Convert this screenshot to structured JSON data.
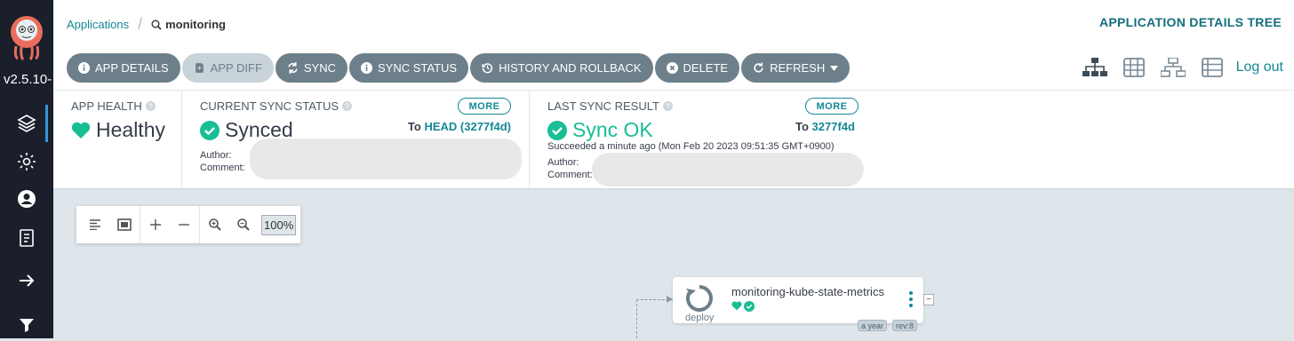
{
  "sidebar": {
    "version": "v2.5.10-",
    "nav": [
      "applications-icon",
      "settings-icon",
      "user-icon",
      "docs-icon",
      "expand-arrow-icon",
      "filter-icon"
    ]
  },
  "breadcrumb": {
    "root": "Applications",
    "current": "monitoring"
  },
  "page_title": "APPLICATION DETAILS TREE",
  "toolbar": {
    "app_details": "APP DETAILS",
    "app_diff": "APP DIFF",
    "sync": "SYNC",
    "sync_status": "SYNC STATUS",
    "history": "HISTORY AND ROLLBACK",
    "delete": "DELETE",
    "refresh": "REFRESH",
    "logout": "Log out"
  },
  "app_health": {
    "title": "APP HEALTH",
    "status": "Healthy",
    "color": "#18be94"
  },
  "sync_status": {
    "title": "CURRENT SYNC STATUS",
    "status": "Synced",
    "more": "MORE",
    "to_label": "To",
    "revision": "HEAD (3277f4d)",
    "author_label": "Author:",
    "comment_label": "Comment:"
  },
  "last_sync": {
    "title": "LAST SYNC RESULT",
    "status": "Sync OK",
    "more": "MORE",
    "to_label": "To",
    "revision": "3277f4d",
    "succeeded": "Succeeded a minute ago (Mon Feb 20 2023 09:51:35 GMT+0900)",
    "author_label": "Author:",
    "comment_label": "Comment:",
    "color": "#18be94"
  },
  "zoom": {
    "level": "100%"
  },
  "node": {
    "name": "monitoring-kube-state-metrics",
    "kind": "deploy",
    "age": "a year",
    "rev": "rev:8",
    "collapse": "−"
  }
}
